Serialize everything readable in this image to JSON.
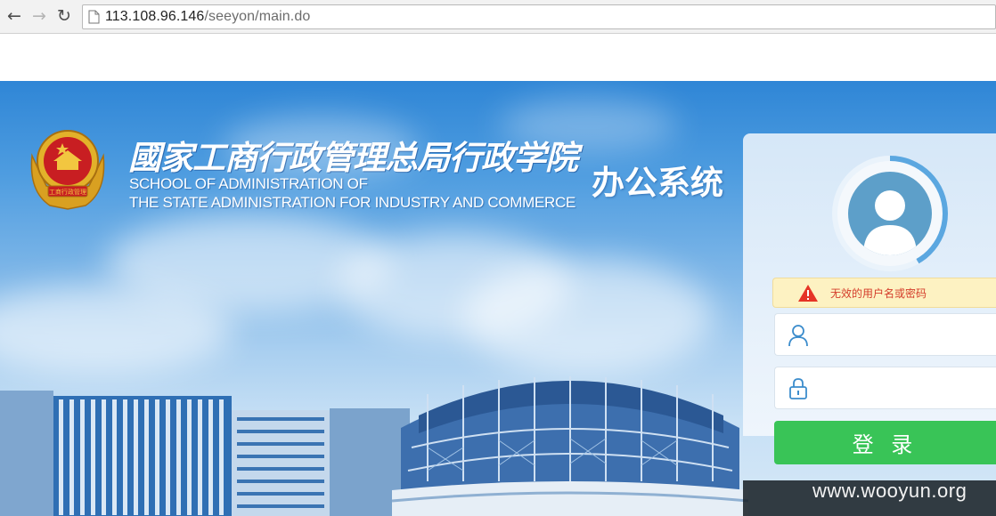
{
  "browser": {
    "back_icon": "arrow-left-icon",
    "forward_icon": "arrow-right-icon",
    "reload_icon": "reload-icon",
    "url_host": "113.108.96.146",
    "url_path": "/seeyon/main.do"
  },
  "header": {
    "emblem": "national-emblem-icon",
    "emblem_caption": "工商行政管理",
    "school_name_cn": "國家工商行政管理总局行政学院",
    "school_name_en_line1": "SCHOOL OF ADMINISTRATION OF",
    "school_name_en_line2": "THE STATE ADMINISTRATION FOR INDUSTRY AND COMMERCE",
    "system_title": "办公系统"
  },
  "login": {
    "avatar_icon": "user-avatar-icon",
    "error_icon": "warning-icon",
    "error_message": "无效的用户名或密码",
    "username_icon": "user-icon",
    "username_value": "",
    "password_icon": "lock-icon",
    "password_value": "",
    "submit_label": "登 录"
  },
  "watermark": "www.wooyun.org",
  "colors": {
    "accent_green": "#39c457",
    "error_red": "#d43c2a",
    "error_bg": "#fdf2c2",
    "sky_blue": "#2f86d6"
  }
}
